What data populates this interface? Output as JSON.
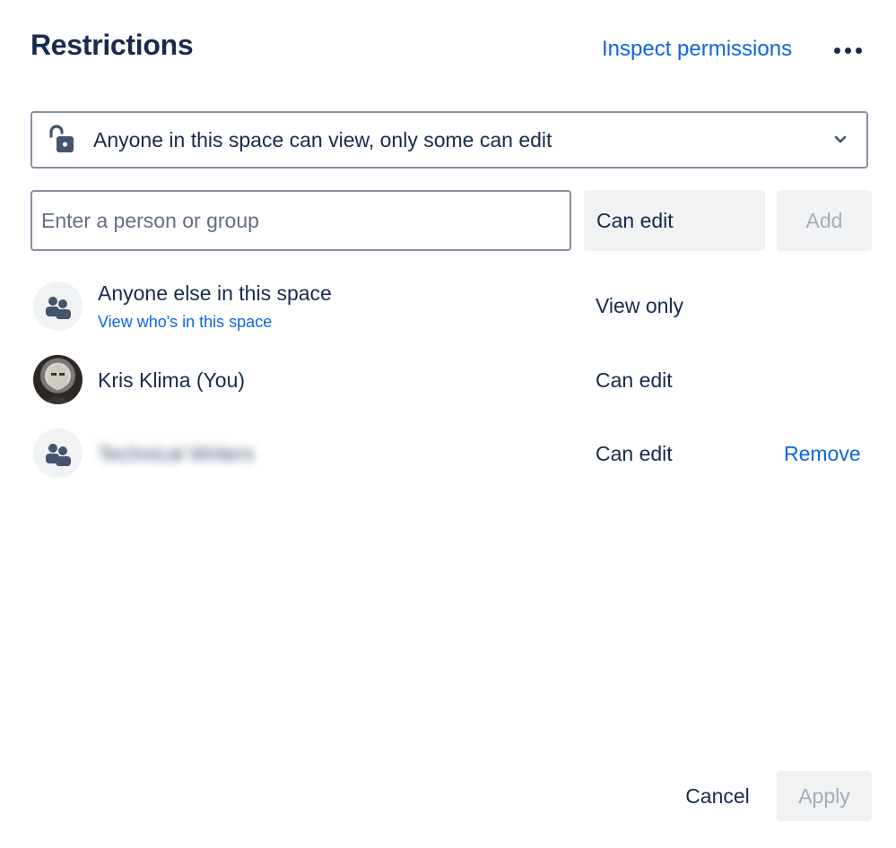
{
  "header": {
    "title": "Restrictions",
    "inspect_label": "Inspect permissions",
    "more_icon": "more-horizontal-icon"
  },
  "restriction_select": {
    "icon": "unlock-icon",
    "value": "Anyone in this space can view, only some can edit",
    "chevron_icon": "chevron-down-icon"
  },
  "add_form": {
    "input_placeholder": "Enter a person or group",
    "input_value": "",
    "permission_value": "Can edit",
    "add_label": "Add"
  },
  "entries": [
    {
      "avatar_icon": "group-icon",
      "name": "Anyone else in this space",
      "sub_link": "View who's in this space",
      "permission": "View only"
    },
    {
      "avatar_icon": "user-photo",
      "name": "Kris Klima (You)",
      "permission": "Can edit"
    },
    {
      "avatar_icon": "group-icon",
      "name": "Technical Writers",
      "permission": "Can edit",
      "action": "Remove"
    }
  ],
  "footer": {
    "cancel_label": "Cancel",
    "apply_label": "Apply"
  },
  "colors": {
    "text": "#172b4d",
    "link": "#0c66e4",
    "disabled_text": "#a5adba",
    "subtle_bg": "#f1f2f4",
    "border": "#8590a2"
  }
}
